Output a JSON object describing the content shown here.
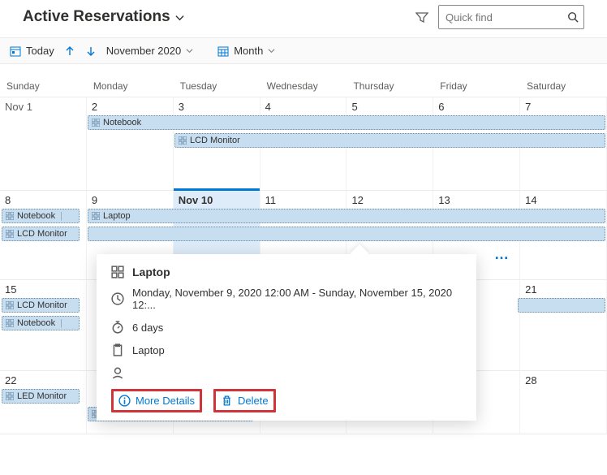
{
  "header": {
    "title": "Active Reservations",
    "search_placeholder": "Quick find"
  },
  "toolbar": {
    "today_label": "Today",
    "period_label": "November 2020",
    "view_label": "Month"
  },
  "weekday_labels": [
    "Sunday",
    "Monday",
    "Tuesday",
    "Wednesday",
    "Thursday",
    "Friday",
    "Saturday"
  ],
  "weeks": {
    "w1": {
      "days": [
        "Nov 1",
        "2",
        "3",
        "4",
        "5",
        "6",
        "7"
      ]
    },
    "w2": {
      "days": [
        "8",
        "9",
        "Nov 10",
        "11",
        "12",
        "13",
        "14"
      ]
    },
    "w3": {
      "days": [
        "15",
        "",
        "",
        "",
        "",
        "",
        "21"
      ]
    },
    "w4": {
      "days": [
        "22",
        "",
        "",
        "",
        "",
        "",
        "28"
      ]
    }
  },
  "events": {
    "w1_notebook": "Notebook",
    "w1_lcd": "LCD Monitor",
    "w2_notebook": "Notebook",
    "w2_lcd": "LCD Monitor",
    "w2_laptop": "Laptop",
    "w3_lcd": "LCD Monitor",
    "w3_notebook": "Notebook",
    "w4_led": "LED Monitor",
    "w4_laptop": "Laptop"
  },
  "popup": {
    "title": "Laptop",
    "time": "Monday, November 9, 2020 12:00 AM - Sunday, November 15, 2020 12:...",
    "duration": "6 days",
    "item": "Laptop",
    "more_details_label": "More Details",
    "delete_label": "Delete"
  }
}
